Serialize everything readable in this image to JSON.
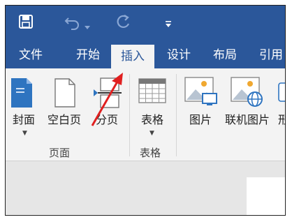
{
  "quick_access": {
    "save_icon": "save-icon",
    "undo_icon": "undo-icon",
    "redo_icon": "redo-icon",
    "customize_icon": "customize-dropdown-icon"
  },
  "tabs": [
    {
      "label": "文件"
    },
    {
      "label": "开始"
    },
    {
      "label": "插入",
      "active": true
    },
    {
      "label": "设计"
    },
    {
      "label": "布局"
    },
    {
      "label": "引用"
    }
  ],
  "ribbon": {
    "pages_group": {
      "label": "页面",
      "cover": "封面",
      "blank_page": "空白页",
      "page_break": "分页"
    },
    "tables_group": {
      "label": "表格",
      "table": "表格"
    },
    "illustrations_group": {
      "picture": "图片",
      "online_picture": "联机图片",
      "shapes_partial": "形"
    }
  },
  "colors": {
    "title_bar": "#2b579a",
    "ribbon": "#f3f3f3",
    "arrow": "#e02020"
  }
}
